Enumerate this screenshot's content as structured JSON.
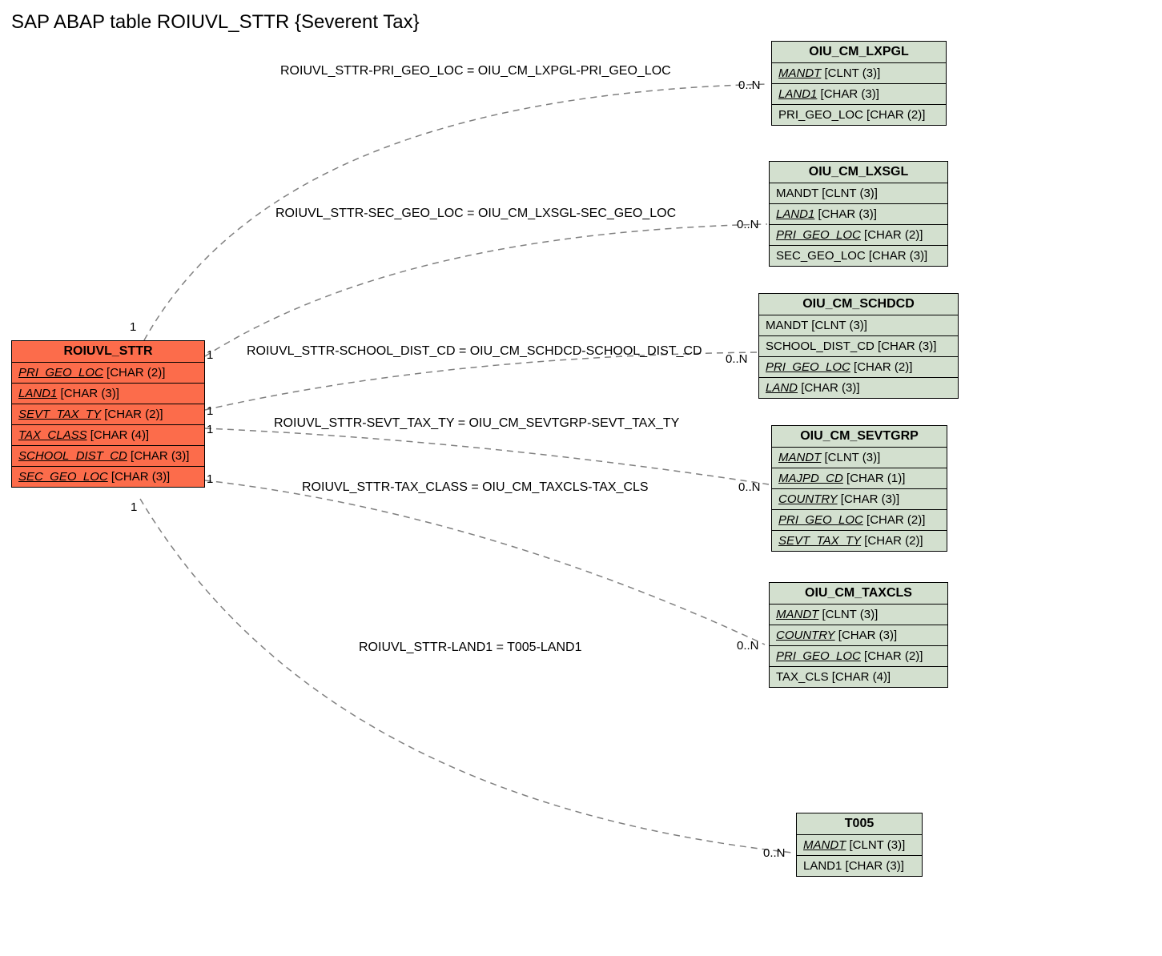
{
  "title": "SAP ABAP table ROIUVL_STTR {Severent Tax}",
  "main_table": {
    "name": "ROIUVL_STTR",
    "fields": [
      {
        "name": "PRI_GEO_LOC",
        "type": "[CHAR (2)]",
        "fk": true
      },
      {
        "name": "LAND1",
        "type": "[CHAR (3)]",
        "fk": true
      },
      {
        "name": "SEVT_TAX_TY",
        "type": "[CHAR (2)]",
        "fk": true
      },
      {
        "name": "TAX_CLASS",
        "type": "[CHAR (4)]",
        "fk": true
      },
      {
        "name": "SCHOOL_DIST_CD",
        "type": "[CHAR (3)]",
        "fk": true
      },
      {
        "name": "SEC_GEO_LOC",
        "type": "[CHAR (3)]",
        "fk": true
      }
    ]
  },
  "ref_tables": [
    {
      "name": "OIU_CM_LXPGL",
      "fields": [
        {
          "name": "MANDT",
          "type": "[CLNT (3)]",
          "fk": true
        },
        {
          "name": "LAND1",
          "type": "[CHAR (3)]",
          "fk": true
        },
        {
          "name": "PRI_GEO_LOC",
          "type": "[CHAR (2)]",
          "fk": false
        }
      ]
    },
    {
      "name": "OIU_CM_LXSGL",
      "fields": [
        {
          "name": "MANDT",
          "type": "[CLNT (3)]",
          "fk": false
        },
        {
          "name": "LAND1",
          "type": "[CHAR (3)]",
          "fk": true
        },
        {
          "name": "PRI_GEO_LOC",
          "type": "[CHAR (2)]",
          "fk": true
        },
        {
          "name": "SEC_GEO_LOC",
          "type": "[CHAR (3)]",
          "fk": false
        }
      ]
    },
    {
      "name": "OIU_CM_SCHDCD",
      "fields": [
        {
          "name": "MANDT",
          "type": "[CLNT (3)]",
          "fk": false
        },
        {
          "name": "SCHOOL_DIST_CD",
          "type": "[CHAR (3)]",
          "fk": false
        },
        {
          "name": "PRI_GEO_LOC",
          "type": "[CHAR (2)]",
          "fk": true
        },
        {
          "name": "LAND",
          "type": "[CHAR (3)]",
          "fk": true
        }
      ]
    },
    {
      "name": "OIU_CM_SEVTGRP",
      "fields": [
        {
          "name": "MANDT",
          "type": "[CLNT (3)]",
          "fk": true
        },
        {
          "name": "MAJPD_CD",
          "type": "[CHAR (1)]",
          "fk": true
        },
        {
          "name": "COUNTRY",
          "type": "[CHAR (3)]",
          "fk": true
        },
        {
          "name": "PRI_GEO_LOC",
          "type": "[CHAR (2)]",
          "fk": true
        },
        {
          "name": "SEVT_TAX_TY",
          "type": "[CHAR (2)]",
          "fk": true
        }
      ]
    },
    {
      "name": "OIU_CM_TAXCLS",
      "fields": [
        {
          "name": "MANDT",
          "type": "[CLNT (3)]",
          "fk": true
        },
        {
          "name": "COUNTRY",
          "type": "[CHAR (3)]",
          "fk": true
        },
        {
          "name": "PRI_GEO_LOC",
          "type": "[CHAR (2)]",
          "fk": true
        },
        {
          "name": "TAX_CLS",
          "type": "[CHAR (4)]",
          "fk": false
        }
      ]
    },
    {
      "name": "T005",
      "fields": [
        {
          "name": "MANDT",
          "type": "[CLNT (3)]",
          "fk": true
        },
        {
          "name": "LAND1",
          "type": "[CHAR (3)]",
          "fk": false
        }
      ]
    }
  ],
  "relations": [
    {
      "label": "ROIUVL_STTR-PRI_GEO_LOC = OIU_CM_LXPGL-PRI_GEO_LOC",
      "left_card": "1",
      "right_card": "0..N"
    },
    {
      "label": "ROIUVL_STTR-SEC_GEO_LOC = OIU_CM_LXSGL-SEC_GEO_LOC",
      "left_card": "1",
      "right_card": "0..N"
    },
    {
      "label": "ROIUVL_STTR-SCHOOL_DIST_CD = OIU_CM_SCHDCD-SCHOOL_DIST_CD",
      "left_card": "1",
      "right_card": "0..N"
    },
    {
      "label": "ROIUVL_STTR-SEVT_TAX_TY = OIU_CM_SEVTGRP-SEVT_TAX_TY",
      "left_card": "1",
      "right_card": "0..N"
    },
    {
      "label": "ROIUVL_STTR-TAX_CLASS = OIU_CM_TAXCLS-TAX_CLS",
      "left_card": "1",
      "right_card": "0..N"
    },
    {
      "label": "ROIUVL_STTR-LAND1 = T005-LAND1",
      "left_card": "1",
      "right_card": "0..N"
    }
  ]
}
